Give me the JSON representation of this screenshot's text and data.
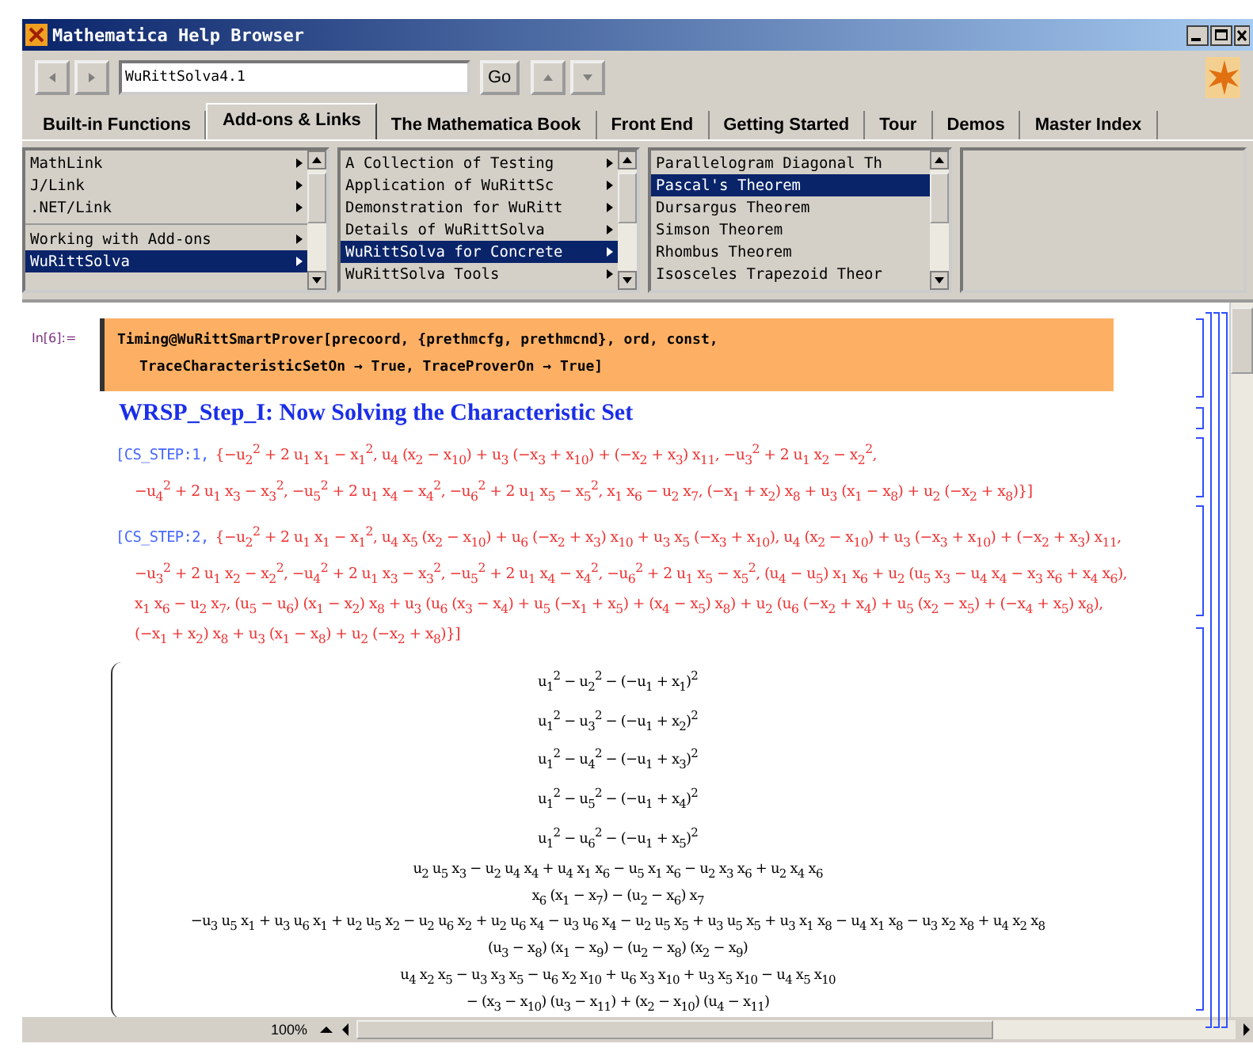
{
  "window": {
    "title": "Mathematica Help Browser"
  },
  "toolbar": {
    "address": "WuRittSolva4.1",
    "go_button": "Go"
  },
  "tabs": [
    {
      "label": "Built-in Functions",
      "selected": false
    },
    {
      "label": "Add-ons & Links",
      "selected": true
    },
    {
      "label": "The Mathematica Book",
      "selected": false
    },
    {
      "label": "Front End",
      "selected": false
    },
    {
      "label": "Getting Started",
      "selected": false
    },
    {
      "label": "Tour",
      "selected": false
    },
    {
      "label": "Demos",
      "selected": false
    },
    {
      "label": "Master Index",
      "selected": false
    }
  ],
  "panes": [
    {
      "items": [
        {
          "kind": "item",
          "label": "MathLink",
          "submenu": true,
          "selected": false
        },
        {
          "kind": "item",
          "label": "J/Link",
          "submenu": true,
          "selected": false
        },
        {
          "kind": "item",
          "label": ".NET/Link",
          "submenu": true,
          "selected": false
        },
        {
          "kind": "separator"
        },
        {
          "kind": "item",
          "label": "Working with Add-ons",
          "submenu": true,
          "selected": false
        },
        {
          "kind": "item",
          "label": "WuRittSolva",
          "submenu": true,
          "selected": true
        }
      ]
    },
    {
      "items": [
        {
          "kind": "item",
          "label": "A Collection of Testing",
          "submenu": true,
          "selected": false
        },
        {
          "kind": "item",
          "label": "Application of  WuRittSc",
          "submenu": true,
          "selected": false
        },
        {
          "kind": "item",
          "label": "Demonstration for WuRitt",
          "submenu": true,
          "selected": false
        },
        {
          "kind": "item",
          "label": "Details of WuRittSolva",
          "submenu": true,
          "selected": false
        },
        {
          "kind": "item",
          "label": "WuRittSolva for Concrete",
          "submenu": true,
          "selected": true
        },
        {
          "kind": "item",
          "label": "WuRittSolva Tools",
          "submenu": true,
          "selected": false
        }
      ]
    },
    {
      "items": [
        {
          "kind": "item",
          "label": "Parallelogram Diagonal Th",
          "submenu": false,
          "selected": false
        },
        {
          "kind": "item",
          "label": "Pascal's Theorem",
          "submenu": false,
          "selected": true
        },
        {
          "kind": "item",
          "label": "Dursargus Theorem",
          "submenu": false,
          "selected": false
        },
        {
          "kind": "item",
          "label": "Simson Theorem",
          "submenu": false,
          "selected": false
        },
        {
          "kind": "item",
          "label": "Rhombus Theorem",
          "submenu": false,
          "selected": false
        },
        {
          "kind": "item",
          "label": "Isosceles Trapezoid Theor",
          "submenu": false,
          "selected": false
        }
      ]
    }
  ],
  "notebook": {
    "input_label": "In[6]:=",
    "input_lines": [
      "Timing@WuRittSmartProver[precoord, {prethmcfg, prethmcnd}, ord, const,",
      "TraceCharacteristicSetOn → True, TraceProverOn → True]"
    ],
    "heading": "WRSP_Step_I: Now Solving the Characteristic Set",
    "steps": [
      {
        "label": "[CS_STEP:1,",
        "lines": [
          "{−u$_{2}$$^{2}$ + 2 u$_{1}$ x$_{1}$ − x$_{1}$$^{2}$, u$_{4}$ (x$_{2}$ − x$_{10}$) + u$_{3}$ (−x$_{3}$ + x$_{10}$) + (−x$_{2}$ + x$_{3}$) x$_{11}$, −u$_{3}$$^{2}$ + 2 u$_{1}$ x$_{2}$ − x$_{2}$$^{2}$,",
          "−u$_{4}$$^{2}$ + 2 u$_{1}$ x$_{3}$ − x$_{3}$$^{2}$, −u$_{5}$$^{2}$ + 2 u$_{1}$ x$_{4}$ − x$_{4}$$^{2}$, −u$_{6}$$^{2}$ + 2 u$_{1}$ x$_{5}$ − x$_{5}$$^{2}$, x$_{1}$ x$_{6}$ − u$_{2}$ x$_{7}$, (−x$_{1}$ + x$_{2}$) x$_{8}$ + u$_{3}$ (x$_{1}$ − x$_{8}$) + u$_{2}$ (−x$_{2}$ + x$_{8}$)}]"
        ]
      },
      {
        "label": "[CS_STEP:2,",
        "lines": [
          "{−u$_{2}$$^{2}$ + 2 u$_{1}$ x$_{1}$ − x$_{1}$$^{2}$, u$_{4}$ x$_{5}$ (x$_{2}$ − x$_{10}$) + u$_{6}$ (−x$_{2}$ + x$_{3}$) x$_{10}$ + u$_{3}$ x$_{5}$ (−x$_{3}$ + x$_{10}$), u$_{4}$ (x$_{2}$ − x$_{10}$) + u$_{3}$ (−x$_{3}$ + x$_{10}$) + (−x$_{2}$ + x$_{3}$) x$_{11}$,",
          "−u$_{3}$$^{2}$ + 2 u$_{1}$ x$_{2}$ − x$_{2}$$^{2}$, −u$_{4}$$^{2}$ + 2 u$_{1}$ x$_{3}$ − x$_{3}$$^{2}$, −u$_{5}$$^{2}$ + 2 u$_{1}$ x$_{4}$ − x$_{4}$$^{2}$, −u$_{6}$$^{2}$ + 2 u$_{1}$ x$_{5}$ − x$_{5}$$^{2}$, (u$_{4}$ − u$_{5}$) x$_{1}$ x$_{6}$ + u$_{2}$ (u$_{5}$ x$_{3}$ − u$_{4}$ x$_{4}$ − x$_{3}$ x$_{6}$ + x$_{4}$ x$_{6}$),",
          "x$_{1}$ x$_{6}$ − u$_{2}$ x$_{7}$, (u$_{5}$ − u$_{6}$) (x$_{1}$ − x$_{2}$) x$_{8}$ + u$_{3}$ (u$_{6}$ (x$_{3}$ − x$_{4}$) + u$_{5}$ (−x$_{1}$ + x$_{5}$) + (x$_{4}$ − x$_{5}$) x$_{8}$) + u$_{2}$ (u$_{6}$ (−x$_{2}$ + x$_{4}$) + u$_{5}$ (x$_{2}$ − x$_{5}$) + (−x$_{4}$ + x$_{5}$) x$_{8}$),",
          "(−x$_{1}$ + x$_{2}$) x$_{8}$ + u$_{3}$ (x$_{1}$ − x$_{8}$) + u$_{2}$ (−x$_{2}$ + x$_{8}$)}]"
        ]
      }
    ],
    "matrix": [
      {
        "kind": "expr",
        "text": "u$_{1}$$^{2}$ − u$_{2}$$^{2}$ − (−u$_{1}$ + x$_{1}$)$^{2}$"
      },
      {
        "kind": "expr",
        "text": "u$_{1}$$^{2}$ − u$_{3}$$^{2}$ − (−u$_{1}$ + x$_{2}$)$^{2}$"
      },
      {
        "kind": "expr",
        "text": "u$_{1}$$^{2}$ − u$_{4}$$^{2}$ − (−u$_{1}$ + x$_{3}$)$^{2}$"
      },
      {
        "kind": "expr",
        "text": "u$_{1}$$^{2}$ − u$_{5}$$^{2}$ − (−u$_{1}$ + x$_{4}$)$^{2}$"
      },
      {
        "kind": "expr",
        "text": "u$_{1}$$^{2}$ − u$_{6}$$^{2}$ − (−u$_{1}$ + x$_{5}$)$^{2}$"
      },
      {
        "kind": "fraction",
        "numerator": "u$_{2}$ u$_{5}$ x$_{3}$ − u$_{2}$ u$_{4}$ x$_{4}$ + u$_{4}$ x$_{1}$ x$_{6}$ − u$_{5}$ x$_{1}$ x$_{6}$ − u$_{2}$ x$_{3}$ x$_{6}$ + u$_{2}$ x$_{4}$ x$_{6}$",
        "denominator": "x$_{6}$ (x$_{1}$ − x$_{7}$) − (u$_{2}$ − x$_{6}$) x$_{7}$"
      },
      {
        "kind": "fraction",
        "numerator": "−u$_{3}$ u$_{5}$ x$_{1}$ + u$_{3}$ u$_{6}$ x$_{1}$ + u$_{2}$ u$_{5}$ x$_{2}$ − u$_{2}$ u$_{6}$ x$_{2}$ + u$_{2}$ u$_{6}$ x$_{4}$ − u$_{3}$ u$_{6}$ x$_{4}$ − u$_{2}$ u$_{5}$ x$_{5}$ + u$_{3}$ u$_{5}$ x$_{5}$ + u$_{3}$ x$_{1}$ x$_{8}$ − u$_{4}$ x$_{1}$ x$_{8}$ − u$_{3}$ x$_{2}$ x$_{8}$ + u$_{4}$ x$_{2}$ x$_{8}$",
        "denominator": "(u$_{3}$ − x$_{8}$) (x$_{1}$ − x$_{9}$) − (u$_{2}$ − x$_{8}$) (x$_{2}$ − x$_{9}$)"
      },
      {
        "kind": "fraction",
        "numerator": "u$_{4}$ x$_{2}$ x$_{5}$ − u$_{3}$ x$_{3}$ x$_{5}$ − u$_{6}$ x$_{2}$ x$_{10}$ + u$_{6}$ x$_{3}$ x$_{10}$ + u$_{3}$ x$_{5}$ x$_{10}$ − u$_{4}$ x$_{5}$ x$_{10}$",
        "denominator": "− (x$_{3}$ − x$_{10}$) (u$_{3}$ − x$_{11}$) + (x$_{2}$ − x$_{10}$) (u$_{4}$ − x$_{11}$)"
      }
    ]
  },
  "status_bar": {
    "zoom": "100%"
  }
}
